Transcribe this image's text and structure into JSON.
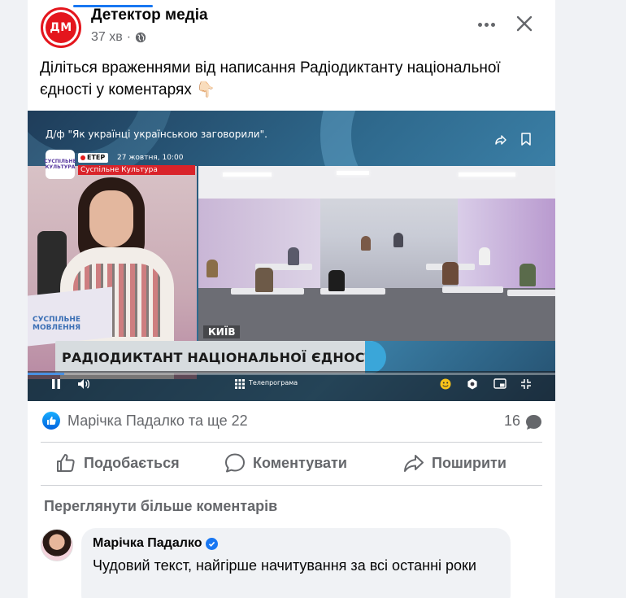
{
  "post": {
    "page_name": "Детектор медіа",
    "avatar_text": "ДМ",
    "time": "37 хв",
    "separator": "·",
    "text": "Діліться враженнями від написання Радіодиктанту національної єдності у коментарях 👇🏻"
  },
  "video": {
    "title": "Д/ф \"Як українці українською заговорили\".",
    "logo_text": "СУСПІЛЬНЕ КУЛЬТУРА",
    "live_label": "ЕТЕР",
    "live_date": "27 жовтня, 10:00",
    "channel_name": "Суспільне Культура",
    "laptop_text": "СУСПІЛЬНЕ МОВЛЕННЯ",
    "city": "КИЇВ",
    "banner": "РАДІОДИКТАНТ НАЦІОНАЛЬНОЇ ЄДНОСТІ",
    "tv_program": "Телепрограма",
    "progress": 0.07
  },
  "reactions": {
    "names": "Марічка Падалко та ще 22",
    "comment_count": "16"
  },
  "actions": {
    "like": "Подобається",
    "comment": "Коментувати",
    "share": "Поширити"
  },
  "comments": {
    "more_label": "Переглянути більше коментарів",
    "items": [
      {
        "author": "Марічка Падалко",
        "text": "Чудовий текст, найгірше начитування за всі останні роки"
      }
    ]
  },
  "colors": {
    "accent": "#1877f2",
    "brand_red": "#e4161d",
    "secondary_text": "#65676b"
  }
}
